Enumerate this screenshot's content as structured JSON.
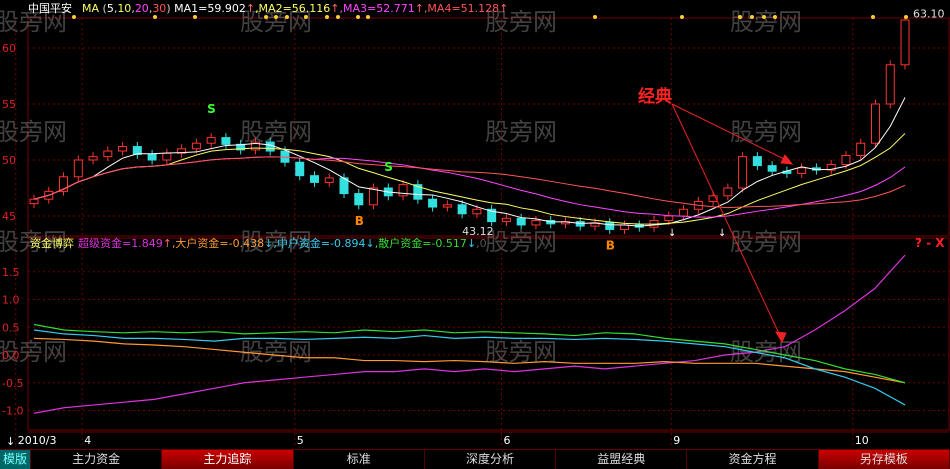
{
  "header": {
    "stock": "中国平安",
    "ma_label": "MA",
    "ma_params": [
      "5",
      "10",
      "20",
      "30"
    ],
    "ma1": "MA1=59.902",
    "ma2": ",MA2=56.116",
    "ma3": ",MA3=52.771",
    "ma4": ",MA4=51.128",
    "up_arrow": "↑",
    "down_arrow": "↓"
  },
  "lower_header": {
    "title": "资金博弈",
    "super": "超级资金=1.849",
    "large": ",大户资金=-0.438",
    "mid": ",中户资金=-0.894",
    "retail": ",散户资金=-0.517",
    "tail": ",0",
    "controls": "? - X"
  },
  "annotation": "经典",
  "watermark": "股旁网",
  "colors": {
    "ma1": "#ffffff",
    "ma2": "#ffff66",
    "ma3": "#ff44ff",
    "ma4": "#ff5555",
    "up": "#ff3333",
    "down": "#33e0e0",
    "super": "#dd33dd",
    "large": "#ff9933",
    "mid": "#33ccee",
    "retail": "#33dd33",
    "grid": "#700000"
  },
  "tabs": [
    "模版",
    "主力资金",
    "主力追踪",
    "标准",
    "深度分析",
    "益盟经典",
    "资金方程",
    "另存模板"
  ],
  "active_tab": 2,
  "chart_data": [
    {
      "type": "candlestick",
      "title": "中国平安",
      "ylim": [
        44,
        63
      ],
      "yticks": [
        60,
        55,
        50,
        45
      ],
      "closes": [
        46.5,
        47.2,
        48.5,
        50.0,
        50.3,
        50.8,
        51.2,
        50.5,
        50.0,
        50.6,
        51.0,
        51.5,
        52.0,
        51.4,
        50.9,
        51.6,
        50.8,
        49.8,
        48.6,
        48.0,
        48.4,
        47.0,
        46.0,
        47.5,
        46.8,
        47.8,
        46.5,
        45.8,
        46.0,
        45.2,
        45.6,
        44.5,
        44.8,
        44.2,
        44.6,
        44.3,
        44.5,
        44.1,
        44.4,
        43.8,
        44.2,
        44.0,
        44.6,
        45.0,
        45.6,
        46.3,
        46.8,
        47.5,
        50.3,
        49.5,
        49.0,
        48.8,
        49.3,
        49.1,
        49.6,
        50.4,
        51.5,
        55.0,
        58.5,
        62.5
      ],
      "ma_periods": [
        5,
        10,
        20,
        30
      ],
      "signals": [
        {
          "label": "S",
          "index": 12,
          "color": "#33ff33"
        },
        {
          "label": "B",
          "index": 22,
          "color": "#ff8800"
        },
        {
          "label": "S",
          "index": 24,
          "color": "#33ff33"
        },
        {
          "label": "B",
          "index": 39,
          "color": "#ff8800"
        }
      ],
      "price_labels": [
        {
          "text": "43.12",
          "index": 29,
          "value": 43.12
        },
        {
          "text": "63.10",
          "index": 59,
          "value": 63.1
        }
      ],
      "xticks": [
        {
          "label": "2010/3",
          "index": -1.1
        },
        {
          "label": "4",
          "index": 3.4
        },
        {
          "label": "5",
          "index": 17.8
        },
        {
          "label": "6",
          "index": 31.8
        },
        {
          "label": "9",
          "index": 43.3
        },
        {
          "label": "10",
          "index": 55.6
        }
      ]
    },
    {
      "type": "line",
      "title": "资金博弈",
      "ylim": [
        -1.2,
        1.8
      ],
      "yticks": [
        "1.5",
        "1.0",
        "0.5",
        "0.0",
        "-0.5",
        "-1.0"
      ],
      "series": [
        {
          "name": "超级资金",
          "color": "#dd33dd",
          "values": [
            -1.05,
            -0.95,
            -0.9,
            -0.85,
            -0.8,
            -0.7,
            -0.6,
            -0.5,
            -0.45,
            -0.4,
            -0.35,
            -0.3,
            -0.3,
            -0.25,
            -0.3,
            -0.25,
            -0.3,
            -0.25,
            -0.2,
            -0.25,
            -0.2,
            -0.15,
            -0.1,
            0.0,
            0.05,
            0.15,
            0.45,
            0.8,
            1.2,
            1.8
          ]
        },
        {
          "name": "大户资金",
          "color": "#ff9933",
          "values": [
            0.3,
            0.28,
            0.25,
            0.2,
            0.18,
            0.15,
            0.1,
            0.05,
            0.0,
            -0.05,
            -0.05,
            -0.1,
            -0.1,
            -0.12,
            -0.1,
            -0.12,
            -0.15,
            -0.12,
            -0.15,
            -0.15,
            -0.15,
            -0.12,
            -0.15,
            -0.15,
            -0.15,
            -0.2,
            -0.25,
            -0.3,
            -0.4,
            -0.5
          ]
        },
        {
          "name": "中户资金",
          "color": "#33ccee",
          "values": [
            0.45,
            0.38,
            0.35,
            0.3,
            0.3,
            0.28,
            0.25,
            0.3,
            0.3,
            0.28,
            0.3,
            0.32,
            0.3,
            0.35,
            0.3,
            0.32,
            0.3,
            0.3,
            0.28,
            0.3,
            0.28,
            0.25,
            0.2,
            0.15,
            0.05,
            -0.05,
            -0.25,
            -0.4,
            -0.6,
            -0.9
          ]
        },
        {
          "name": "散户资金",
          "color": "#33dd33",
          "values": [
            0.55,
            0.45,
            0.42,
            0.4,
            0.42,
            0.4,
            0.42,
            0.38,
            0.4,
            0.42,
            0.4,
            0.45,
            0.42,
            0.45,
            0.4,
            0.42,
            0.4,
            0.38,
            0.35,
            0.4,
            0.38,
            0.3,
            0.25,
            0.2,
            0.1,
            0.0,
            -0.1,
            -0.25,
            -0.35,
            -0.5
          ]
        }
      ]
    }
  ]
}
